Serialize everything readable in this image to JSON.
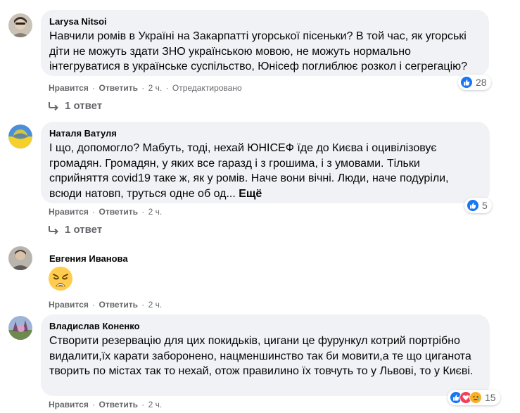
{
  "colors": {
    "bubble": "#f0f2f5",
    "secondary_text": "#65676b",
    "like_blue": "#1877f2",
    "love_red": "#f33e58",
    "sad_yellow": "#f7b125"
  },
  "comments": [
    {
      "author": "Larysa Nitsoi",
      "text": "Навчили ромів в Україні на Закарпатті угорської пісеньки? В той час, як угорські діти не можуть здати ЗНО українською мовою, не можуть нормально інтегруватися в українське суспільство, Юнісеф поглиблює розкол і сегрегацію?",
      "like_label": "Нравится",
      "reply_label": "Ответить",
      "time": "2 ч.",
      "edited": "Отредактировано",
      "reactions": {
        "icons": [
          "like-icon"
        ],
        "count": "28"
      },
      "replies_label": "1 ответ"
    },
    {
      "author": "Наталя Ватуля",
      "text": "І що, допомогло? Мабуть, тоді, нехай ЮНІСЕФ їде до Києва і оцивілізовує громадян. Громадян, у яких все гаразд і з грошима, і з умовами. Тільки сприйняття covid19 таке ж, як у ромів. Наче вони вічні. Люди, наче подуріли, всюди натовп, труться одне об од...",
      "more_label": "Ещё",
      "like_label": "Нравится",
      "reply_label": "Ответить",
      "time": "2 ч.",
      "reactions": {
        "icons": [
          "like-icon"
        ],
        "count": "5"
      },
      "replies_label": "1 ответ"
    },
    {
      "author": "Евгения Иванова",
      "emoji": "weary-face-icon",
      "like_label": "Нравится",
      "reply_label": "Ответить",
      "time": "2 ч."
    },
    {
      "author": "Владислав Коненко",
      "text": "Створити резервацію для цих покидьків, цигани це фурункул котрий портрібно видалити,їх карати заборонено, нацменшинство так би мовити,а те що циганота творить по містах так то нехай, отож правилино їх товчуть то у Львові, то у Києві.",
      "like_label": "Нравится",
      "reply_label": "Ответить",
      "time": "2 ч.",
      "reactions": {
        "icons": [
          "like-icon",
          "love-icon",
          "sad-icon"
        ],
        "count": "15"
      }
    }
  ]
}
